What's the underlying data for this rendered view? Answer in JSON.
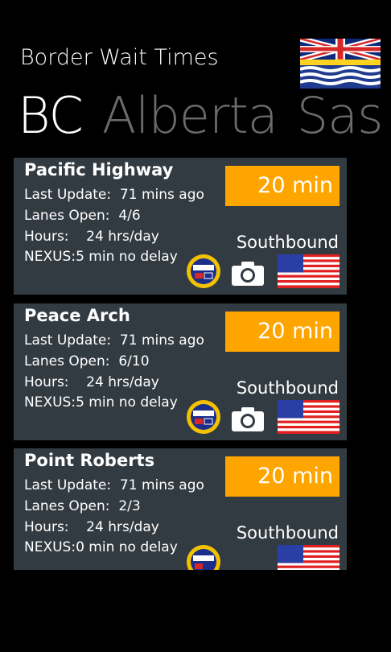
{
  "app": {
    "title": "Border Wait Times"
  },
  "pivot": {
    "items": [
      "BC",
      "Alberta",
      "Sas"
    ]
  },
  "colors": {
    "accent": "#ffa500",
    "card_bg": "#333b42",
    "inactive_pivot": "#6b6b6b"
  },
  "labels": {
    "last_update": "Last Update:",
    "lanes_open": "Lanes Open:",
    "hours": "Hours:"
  },
  "crossings": [
    {
      "name": "Pacific Highway",
      "last_update": "71 mins ago",
      "lanes": "4/6",
      "hours": "24 hrs/day",
      "nexus": "NEXUS:5 min no delay",
      "wait": "20 min",
      "direction": "Southbound"
    },
    {
      "name": "Peace Arch",
      "last_update": "71 mins ago",
      "lanes": "6/10",
      "hours": "24 hrs/day",
      "nexus": "NEXUS:5 min no delay",
      "wait": "20 min",
      "direction": "Southbound"
    },
    {
      "name": "Point Roberts",
      "last_update": "71 mins ago",
      "lanes": "2/3",
      "hours": "24 hrs/day",
      "nexus": "NEXUS:0 min no delay",
      "wait": "20 min",
      "direction": "Southbound"
    }
  ]
}
